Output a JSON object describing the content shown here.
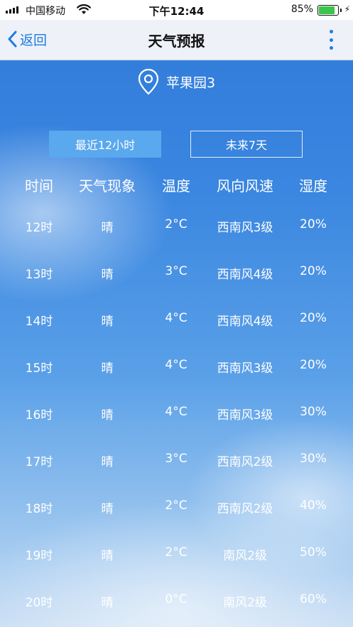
{
  "status_bar": {
    "carrier": "中国移动",
    "time": "下午12:44",
    "battery_percent": "85%",
    "battery_level": 0.85,
    "icons": [
      "signal-icon",
      "wifi-icon",
      "battery-icon",
      "charging-icon"
    ]
  },
  "nav": {
    "back_label": "返回",
    "title": "天气预报",
    "accent_color": "#1f7de0"
  },
  "location": {
    "name": "苹果园3",
    "icon": "location-pin-icon"
  },
  "tabs": [
    {
      "label": "最近12小时",
      "active": true
    },
    {
      "label": "未来7天",
      "active": false
    }
  ],
  "table": {
    "headers": [
      "时间",
      "天气现象",
      "温度",
      "风向风速",
      "湿度"
    ],
    "rows": [
      {
        "time": "12时",
        "weather": "晴",
        "temp": "2°C",
        "wind": "西南风3级",
        "humidity": "20%"
      },
      {
        "time": "13时",
        "weather": "晴",
        "temp": "3°C",
        "wind": "西南风4级",
        "humidity": "20%"
      },
      {
        "time": "14时",
        "weather": "晴",
        "temp": "4°C",
        "wind": "西南风4级",
        "humidity": "20%"
      },
      {
        "time": "15时",
        "weather": "晴",
        "temp": "4°C",
        "wind": "西南风3级",
        "humidity": "20%"
      },
      {
        "time": "16时",
        "weather": "晴",
        "temp": "4°C",
        "wind": "西南风3级",
        "humidity": "30%"
      },
      {
        "time": "17时",
        "weather": "晴",
        "temp": "3°C",
        "wind": "西南风2级",
        "humidity": "30%"
      },
      {
        "time": "18时",
        "weather": "晴",
        "temp": "2°C",
        "wind": "西南风2级",
        "humidity": "40%"
      },
      {
        "time": "19时",
        "weather": "晴",
        "temp": "2°C",
        "wind": "南风2级",
        "humidity": "50%"
      },
      {
        "time": "20时",
        "weather": "晴",
        "temp": "0°C",
        "wind": "南风2级",
        "humidity": "60%"
      }
    ]
  }
}
